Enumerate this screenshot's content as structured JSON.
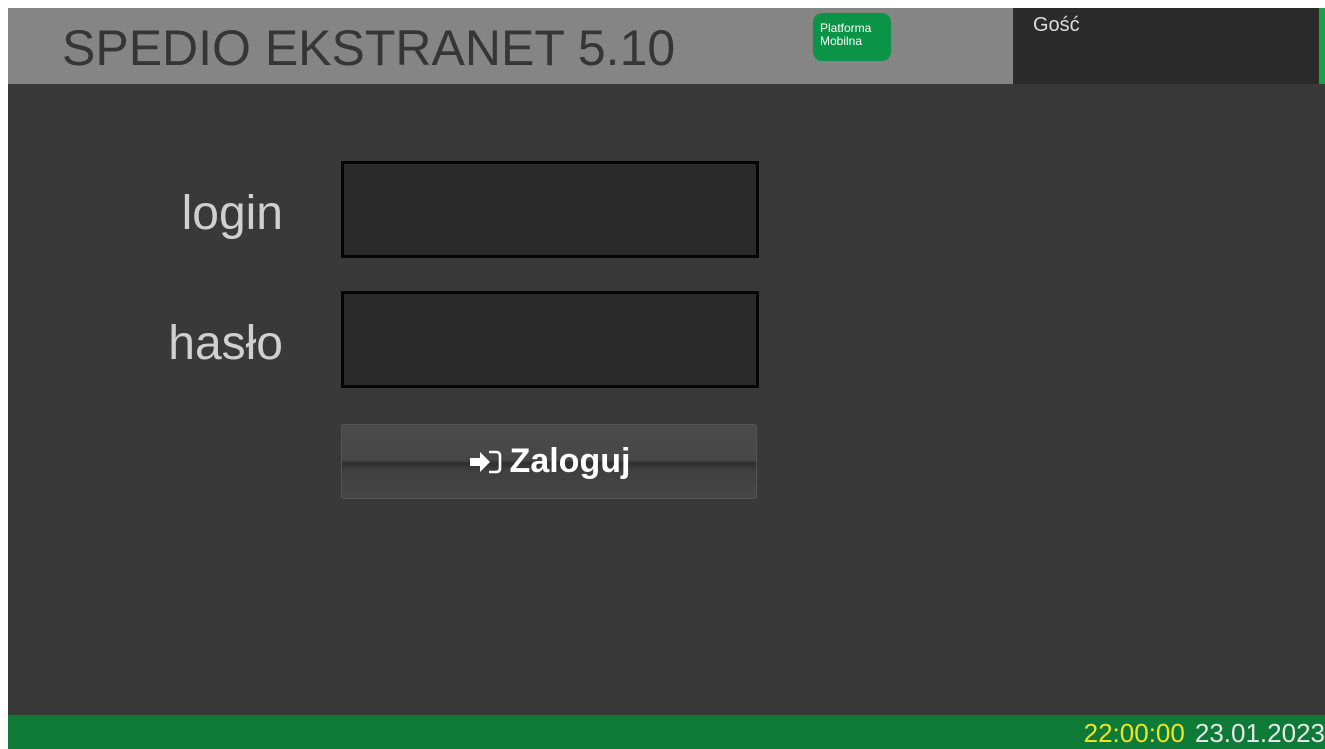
{
  "header": {
    "title": "SPEDIO EKSTRANET 5.10",
    "badge_line1": "Platforma",
    "badge_line2": "Mobilna",
    "user": "Gość"
  },
  "form": {
    "login_label": "login",
    "password_label": "hasło",
    "login_value": "",
    "password_value": "",
    "submit_label": "Zaloguj",
    "submit_icon": "sign-in-icon"
  },
  "footer": {
    "time": "22:00:00",
    "date": "23.01.2023"
  },
  "colors": {
    "background": "#393939",
    "header": "#858585",
    "accent_green": "#0b9447",
    "footer_green": "#0d7a37",
    "time_yellow": "#f1e422"
  }
}
